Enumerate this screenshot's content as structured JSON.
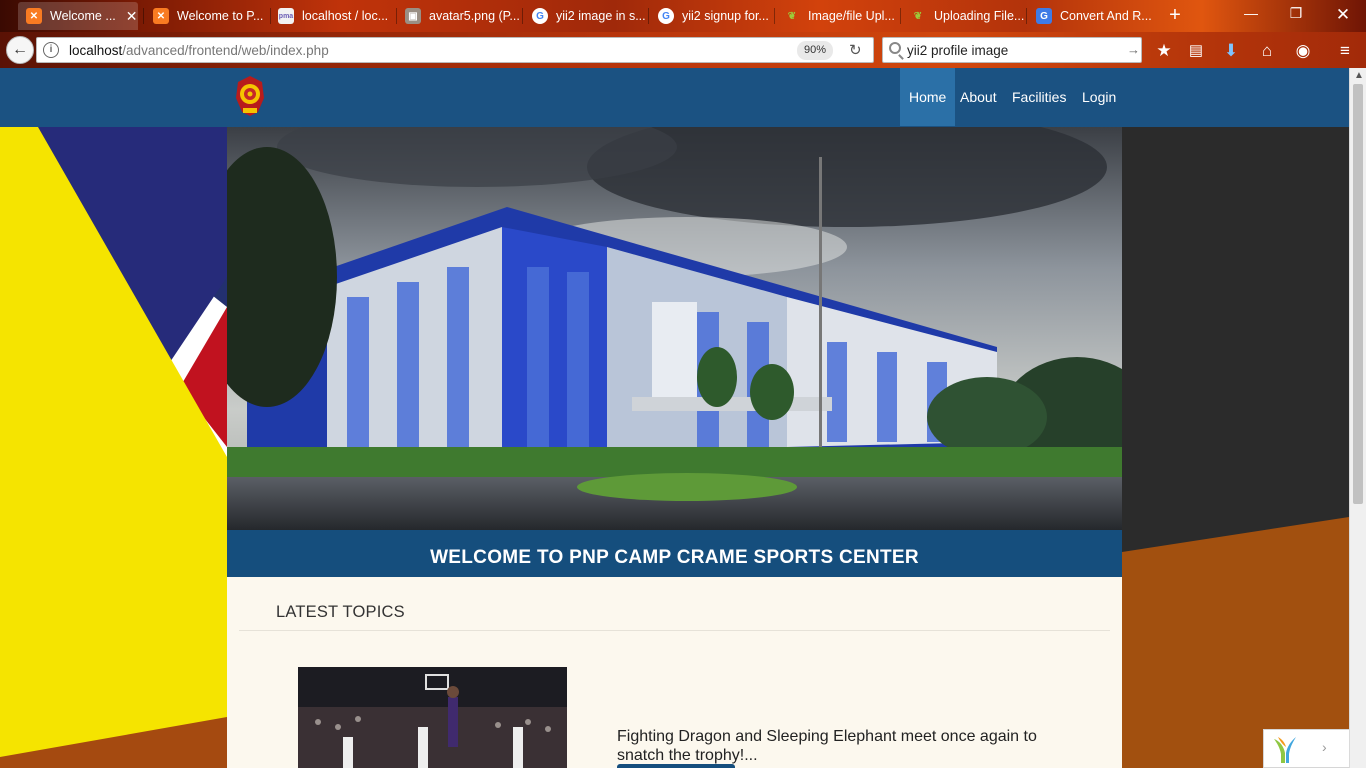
{
  "browser": {
    "tabs": [
      {
        "title": "Welcome ...",
        "icon": "xampp-icon",
        "active": true
      },
      {
        "title": "Welcome to P...",
        "icon": "xampp-icon"
      },
      {
        "title": "localhost / loc...",
        "icon": "phpmyadmin-icon"
      },
      {
        "title": "avatar5.png (P...",
        "icon": "image-icon"
      },
      {
        "title": "yii2 image in s...",
        "icon": "google-icon"
      },
      {
        "title": "yii2 signup for...",
        "icon": "google-icon"
      },
      {
        "title": "Image/file Upl...",
        "icon": "yii-icon"
      },
      {
        "title": "Uploading File...",
        "icon": "yii-icon"
      },
      {
        "title": "Convert And R...",
        "icon": "google-icon"
      }
    ],
    "url_host": "localhost",
    "url_path": "/advanced/frontend/web/index.php",
    "zoom": "90%",
    "search_query": "yii2 profile image"
  },
  "site": {
    "nav": {
      "home": "Home",
      "about": "About",
      "facilities": "Facilities",
      "login": "Login"
    },
    "banner_title": "WELCOME TO PNP CAMP CRAME SPORTS CENTER",
    "latest_heading": "LATEST TOPICS",
    "topics": [
      {
        "text": "Fighting Dragon and Sleeping Elephant meet once again to snatch the trophy!..."
      }
    ]
  },
  "colors": {
    "navbar": "#1b5282",
    "nav_active": "#2b70a7",
    "banner": "#154e7d",
    "content_bg": "#fcf8ee"
  }
}
